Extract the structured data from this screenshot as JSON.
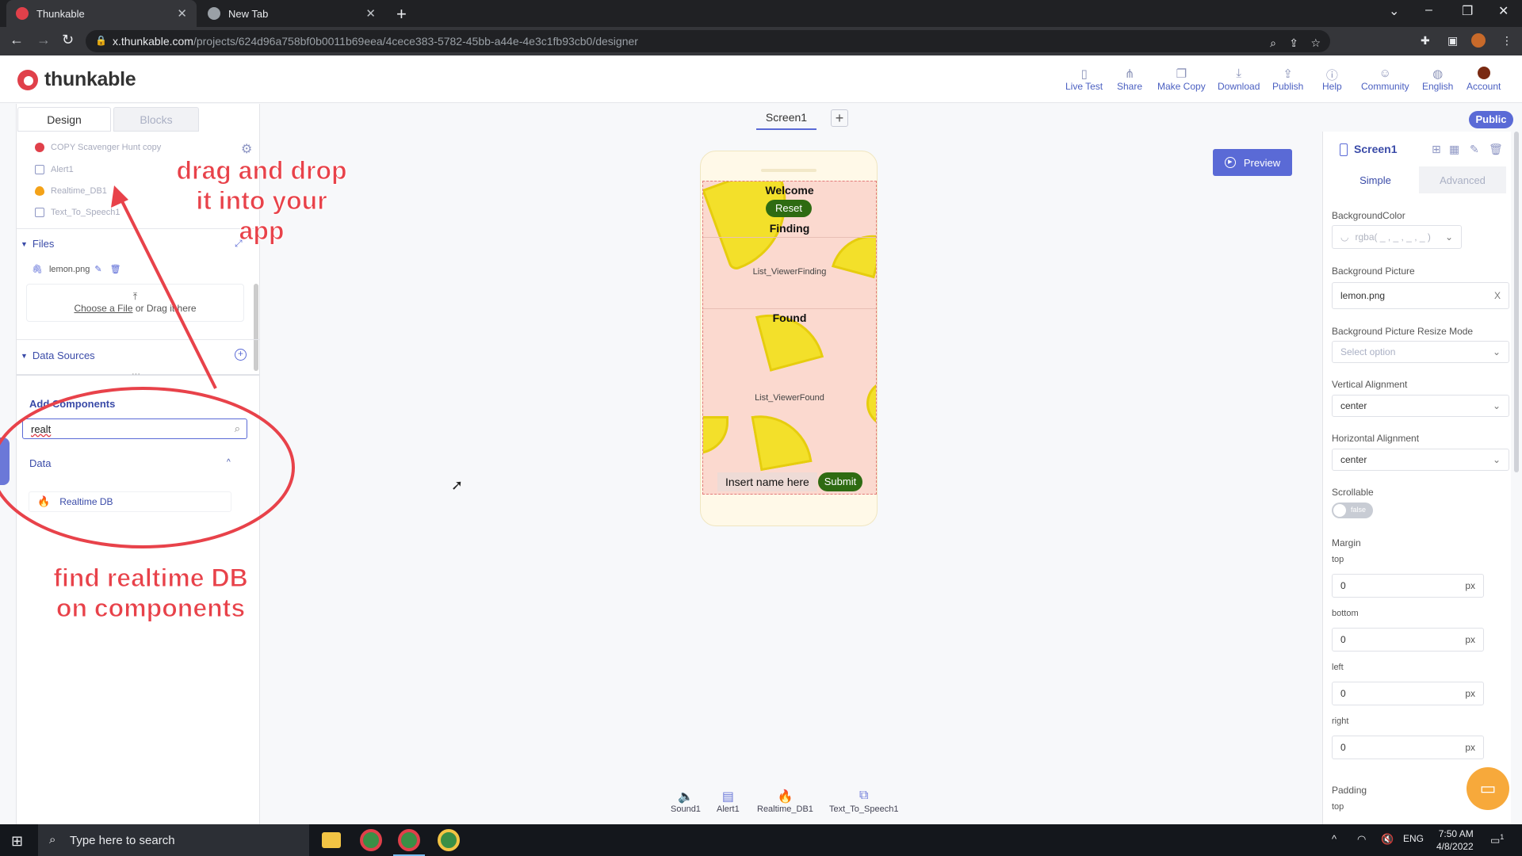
{
  "browser": {
    "tabs": [
      {
        "title": "Thunkable"
      },
      {
        "title": "New Tab"
      }
    ],
    "url_host": "x.thunkable.com",
    "url_path": "/projects/624d96a758bf0b0011b69eea/4cece383-5782-45bb-a44e-4e3c1fb93cb0/designer"
  },
  "app": {
    "logo_text": "thunkable",
    "header_items": [
      {
        "label": "Live Test",
        "icon": "phone-icon"
      },
      {
        "label": "Share",
        "icon": "share-icon"
      },
      {
        "label": "Make Copy",
        "icon": "copy-icon"
      },
      {
        "label": "Download",
        "icon": "download-icon"
      },
      {
        "label": "Publish",
        "icon": "publish-icon"
      },
      {
        "label": "Help",
        "icon": "help-icon"
      },
      {
        "label": "Community",
        "icon": "community-icon"
      },
      {
        "label": "English",
        "icon": "globe-icon"
      },
      {
        "label": "Account",
        "icon": "avatar-icon"
      }
    ]
  },
  "left": {
    "tabs": [
      "Design",
      "Blocks"
    ],
    "tree": [
      {
        "label": "COPY Scavenger Hunt copy",
        "color": "#e0404a"
      },
      {
        "label": "Alert1",
        "color": "#8e96c4"
      },
      {
        "label": "Realtime_DB1",
        "color": "#f4a218"
      },
      {
        "label": "Text_To_Speech1",
        "color": "#8e96c4"
      }
    ],
    "files_header": "Files",
    "file_name": "lemon.png",
    "dropzone_link": "Choose a File",
    "dropzone_text": "or Drag it here",
    "data_sources_header": "Data Sources",
    "add_components_header": "Add Components",
    "search_value": "realt",
    "data_category": "Data",
    "component_result": "Realtime DB"
  },
  "annotations": {
    "drag_text_1": "drag and drop",
    "drag_text_2": "it into your",
    "drag_text_3": "app",
    "find_text_1": "find realtime DB",
    "find_text_2": "on components"
  },
  "designer": {
    "screen_tab": "Screen1",
    "public_badge": "Public",
    "preview_label": "Preview",
    "phone": {
      "welcome": "Welcome",
      "reset": "Reset",
      "finding": "Finding",
      "list_finding": "List_ViewerFinding",
      "found": "Found",
      "list_found": "List_ViewerFound",
      "input_placeholder": "Insert name here",
      "submit": "Submit"
    },
    "bottom_components": [
      {
        "label": "Sound1",
        "icon": "sound-icon"
      },
      {
        "label": "Alert1",
        "icon": "alert-icon"
      },
      {
        "label": "Realtime_DB1",
        "icon": "flame-icon"
      },
      {
        "label": "Text_To_Speech1",
        "icon": "speech-icon"
      }
    ]
  },
  "right": {
    "title": "Screen1",
    "tabs": [
      "Simple",
      "Advanced"
    ],
    "bg_color_label": "BackgroundColor",
    "bg_color_value": "rgba( _ , _ , _ , _ )",
    "bg_picture_label": "Background Picture",
    "bg_picture_value": "lemon.png",
    "bg_picture_clear": "X",
    "resize_label": "Background Picture Resize Mode",
    "resize_value": "Select option",
    "valign_label": "Vertical Alignment",
    "valign_value": "center",
    "halign_label": "Horizontal Alignment",
    "halign_value": "center",
    "scrollable_label": "Scrollable",
    "scrollable_value": "false",
    "margin_label": "Margin",
    "margin": [
      {
        "side": "top",
        "value": "0"
      },
      {
        "side": "bottom",
        "value": "0"
      },
      {
        "side": "left",
        "value": "0"
      },
      {
        "side": "right",
        "value": "0"
      }
    ],
    "unit": "px",
    "padding_label": "Padding",
    "padding_top_label": "top"
  },
  "taskbar": {
    "search_placeholder": "Type here to search",
    "lang": "ENG",
    "time": "7:50 AM",
    "date": "4/8/2022",
    "notif_count": "1"
  }
}
